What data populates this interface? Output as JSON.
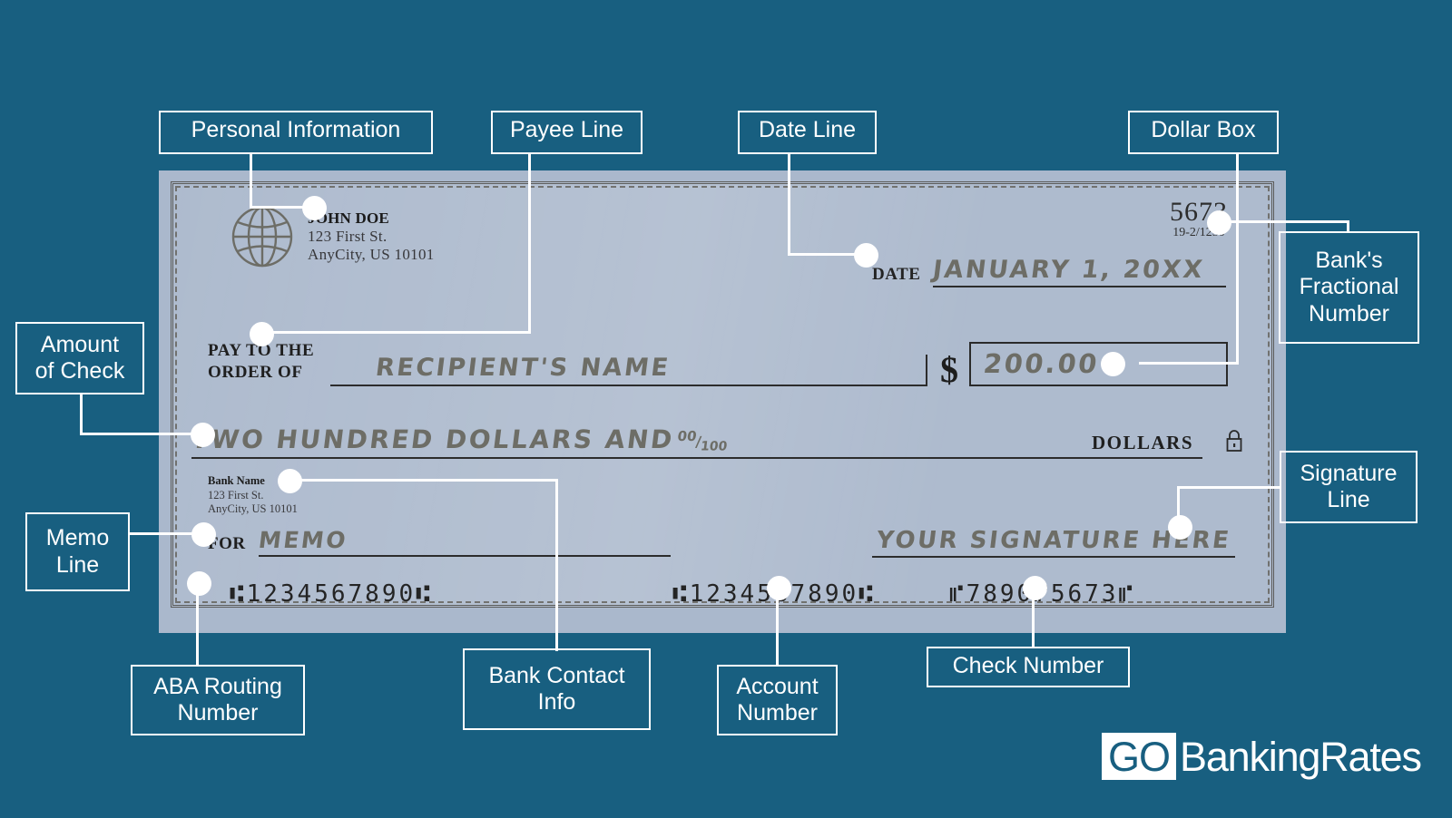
{
  "page": {
    "background_color": "#185f80",
    "check_body_color": "#aebbce"
  },
  "check": {
    "personal_information": {
      "icon": "globe-icon",
      "name": "JOHN DOE",
      "street": "123 First St.",
      "city_state_zip": "AnyCity, US 10101"
    },
    "check_number": "5673",
    "fractional_number": "19-2/1250",
    "date_label": "DATE",
    "date_value": "JANUARY 1, 20XX",
    "pay_to_label_line1": "PAY TO THE",
    "pay_to_label_line2": "ORDER OF",
    "payee_value": "RECIPIENT'S NAME",
    "dollar_sign": "$",
    "amount_numeric": "200.00",
    "amount_written": "TWO HUNDRED DOLLARS AND",
    "amount_written_fraction_numerator": "00",
    "amount_written_fraction_denominator": "100",
    "dollars_label": "DOLLARS",
    "security_icon": "lock-icon",
    "bank_contact": {
      "name": "Bank Name",
      "street": "123 First St.",
      "city_state_zip": "AnyCity, US 10101"
    },
    "memo_label": "FOR",
    "memo_value": "MEMO",
    "signature_value": "YOUR SIGNATURE HERE",
    "micr_routing": "⑆1234567890⑆",
    "micr_account": "⑆1234567890⑆",
    "micr_check_number": "⑈7890⑈5673⑈"
  },
  "callouts": {
    "personal_information": "Personal Information",
    "payee_line": "Payee Line",
    "date_line": "Date Line",
    "dollar_box": "Dollar Box",
    "bank_fractional_number": "Bank's\nFractional\nNumber",
    "amount_of_check": "Amount\nof Check",
    "signature_line": "Signature\nLine",
    "memo_line": "Memo\nLine",
    "aba_routing_number": "ABA Routing\nNumber",
    "bank_contact_info": "Bank Contact\nInfo",
    "account_number": "Account\nNumber",
    "check_number": "Check Number"
  },
  "logo": {
    "mark": "GO",
    "wordmark": "BankingRates"
  }
}
